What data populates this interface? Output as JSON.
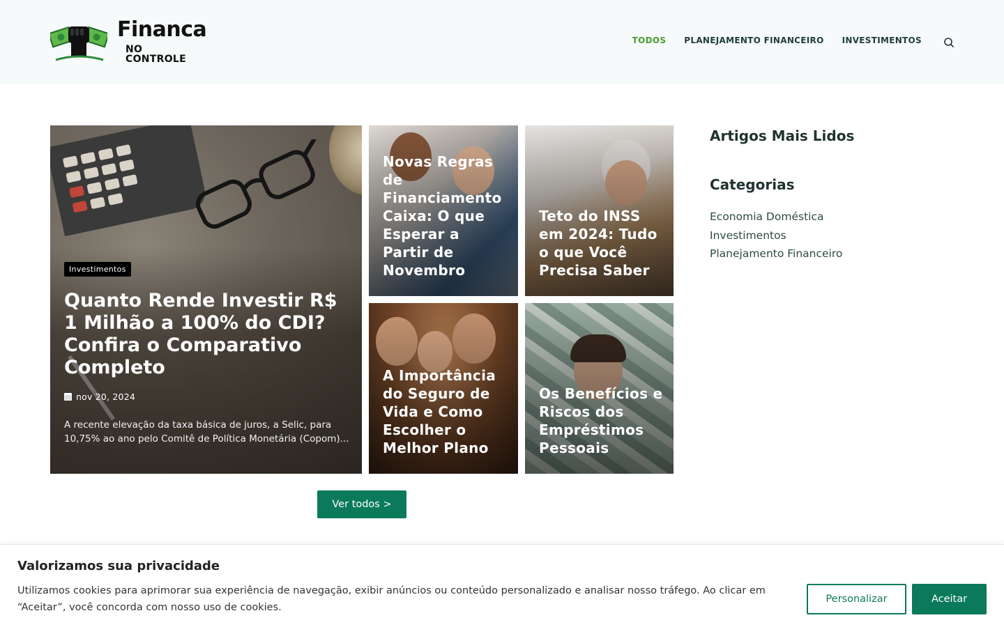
{
  "brand": {
    "line1": "Financa",
    "line2": "NO CONTROLE"
  },
  "nav": {
    "items": [
      {
        "label": "TODOS",
        "active": true
      },
      {
        "label": "PLANEJAMENTO FINANCEIRO",
        "active": false
      },
      {
        "label": "INVESTIMENTOS",
        "active": false
      }
    ]
  },
  "featured": {
    "category": "Investimentos",
    "title": "Quanto Rende Investir R$ 1 Milhão a 100% do CDI? Confira o Comparativo Completo",
    "date": "nov 20, 2024",
    "excerpt": "A recente elevação da taxa básica de juros, a Selic, para 10,75% ao ano pelo Comitê de Política Monetária (Copom)..."
  },
  "posts": [
    {
      "title": "Novas Regras de Financiamento Caixa: O que Esperar a Partir de Novembro"
    },
    {
      "title": "Teto do INSS em 2024: Tudo o que Você Precisa Saber"
    },
    {
      "title": "A Importância do Seguro de Vida e Como Escolher o Melhor Plano"
    },
    {
      "title": "Os Benefícios e Riscos dos Empréstimos Pessoais"
    }
  ],
  "view_all_label": "Ver todos >",
  "sidebar": {
    "most_read_title": "Artigos Mais Lidos",
    "categories_title": "Categorias",
    "categories": [
      "Economia Doméstica",
      "Investimentos",
      "Planejamento Financeiro"
    ]
  },
  "cookie": {
    "title": "Valorizamos sua privacidade",
    "text": "Utilizamos cookies para aprimorar sua experiência de navegação, exibir anúncios ou conteúdo personalizado e analisar nosso tráfego. Ao clicar em “Aceitar”, você concorda com nosso uso de cookies.",
    "customize_label": "Personalizar",
    "accept_label": "Aceitar"
  },
  "colors": {
    "accent": "#0b7a5a",
    "nav_active": "#4a9c34",
    "header_bg": "#f7fafa"
  }
}
